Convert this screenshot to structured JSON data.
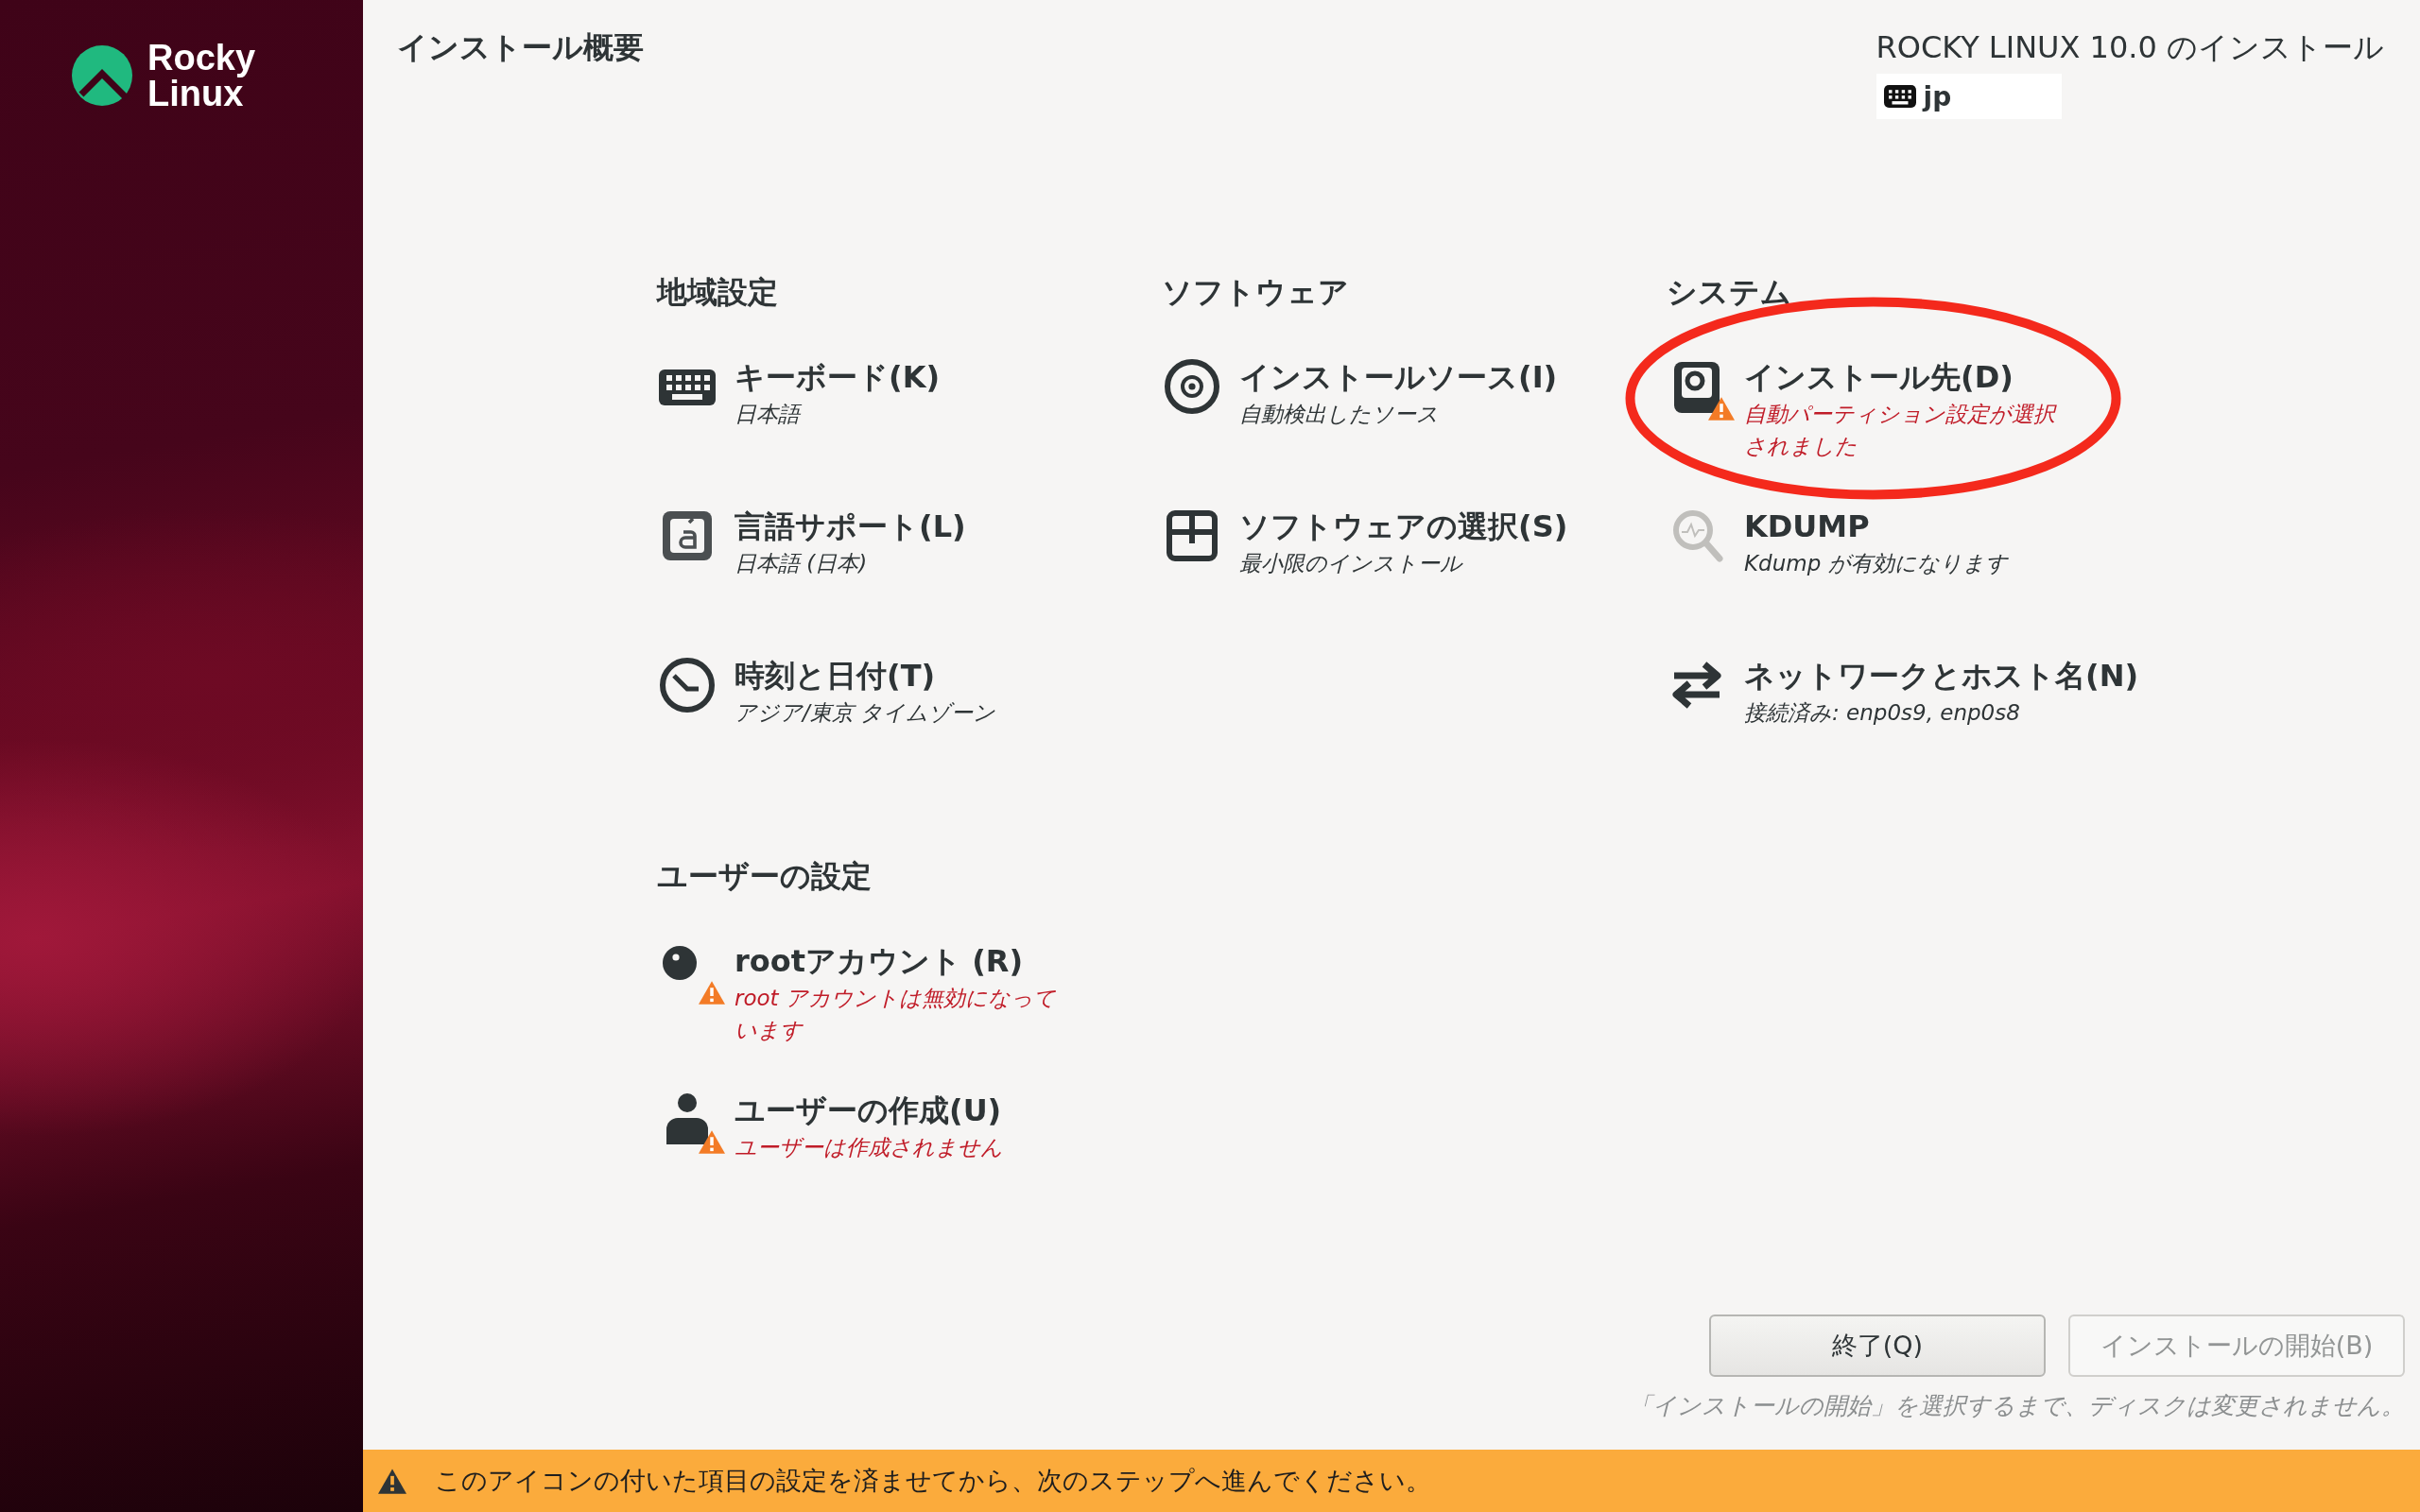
{
  "logo": [
    "Rocky",
    "Linux"
  ],
  "header": {
    "title": "インストール概要",
    "product": "ROCKY LINUX 10.0 のインストール",
    "keyboard_layout": "jp"
  },
  "sections": [
    {
      "heading": "地域設定",
      "spokes": [
        {
          "kind": "keyboard",
          "title": "キーボード(K)",
          "status": "日本語",
          "warning": false,
          "highlighted": false
        },
        {
          "kind": "language",
          "title": "言語サポート(L)",
          "status": "日本語 (日本)",
          "warning": false,
          "highlighted": false
        },
        {
          "kind": "clock",
          "title": "時刻と日付(T)",
          "status": "アジア/東京 タイムゾーン",
          "warning": false,
          "highlighted": false
        }
      ]
    },
    {
      "heading": "ソフトウェア",
      "spokes": [
        {
          "kind": "disc",
          "title": "インストールソース(I)",
          "status": "自動検出したソース",
          "warning": false,
          "highlighted": false
        },
        {
          "kind": "package",
          "title": "ソフトウェアの選択(S)",
          "status": "最小限のインストール",
          "warning": false,
          "highlighted": false
        }
      ]
    },
    {
      "heading": "システム",
      "spokes": [
        {
          "kind": "disk",
          "title": "インストール先(D)",
          "status": "自動パーティション設定が選択されました",
          "warning": true,
          "highlighted": true
        },
        {
          "kind": "magnifier",
          "title": "KDUMP",
          "status": "Kdump が有効になります",
          "warning": false,
          "highlighted": false
        },
        {
          "kind": "network",
          "title": "ネットワークとホスト名(N)",
          "status": "接続済み: enp0s9, enp0s8",
          "warning": false,
          "highlighted": false
        }
      ]
    },
    {
      "heading": "ユーザーの設定",
      "spokes": [
        {
          "kind": "root",
          "title": "rootアカウント (R)",
          "status": "root アカウントは無効になっています",
          "warning": true,
          "highlighted": false
        },
        {
          "kind": "user",
          "title": "ユーザーの作成(U)",
          "status": "ユーザーは作成されません",
          "warning": true,
          "highlighted": false
        }
      ]
    }
  ],
  "buttons": [
    {
      "label": "終了(Q)",
      "disabled": false
    },
    {
      "label": "インストールの開始(B)",
      "disabled": true
    }
  ],
  "note": "「インストールの開始」を選択するまで、ディスクは変更されません。",
  "warning_bar": "このアイコンの付いた項目の設定を済ませてから、次のステップへ進んでください。"
}
